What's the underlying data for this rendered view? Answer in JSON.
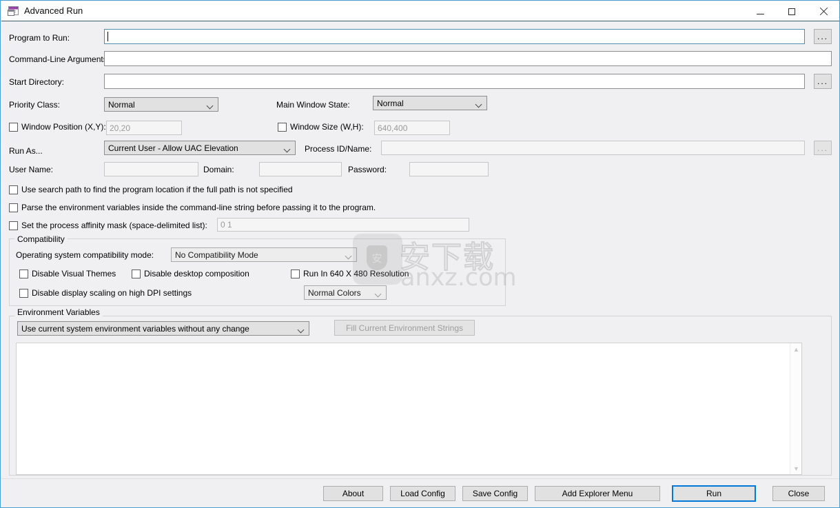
{
  "window": {
    "title": "Advanced Run",
    "icon": "app-window-icon",
    "minimize_label": "Minimize",
    "maximize_label": "Maximize",
    "close_label": "Close",
    "accent_border": "#4a9fd0",
    "client_background": "#f0eff1"
  },
  "fields": {
    "program_to_run": {
      "label": "Program to Run:",
      "value": "",
      "browse_label": "...",
      "focused": true
    },
    "command_line_arguments": {
      "label": "Command-Line Arguments:",
      "value": ""
    },
    "start_directory": {
      "label": "Start Directory:",
      "value": "",
      "browse_label": "..."
    },
    "priority_class": {
      "label": "Priority Class:",
      "value": "Normal"
    },
    "main_window_state": {
      "label": "Main Window State:",
      "value": "Normal"
    },
    "window_position": {
      "label": "Window Position (X,Y):",
      "checked": false,
      "placeholder": "20,20"
    },
    "window_size": {
      "label": "Window Size (W,H):",
      "checked": false,
      "placeholder": "640,400"
    },
    "run_as": {
      "label": "Run As...",
      "value": "Current User - Allow UAC Elevation"
    },
    "process_id_name": {
      "label": "Process ID/Name:",
      "value": "",
      "browse_label": "...",
      "disabled": true
    },
    "user_name": {
      "label": "User Name:",
      "value": "",
      "disabled": true
    },
    "domain": {
      "label": "Domain:",
      "value": "",
      "disabled": true
    },
    "password": {
      "label": "Password:",
      "value": "",
      "disabled": true
    }
  },
  "options": {
    "use_search_path": {
      "label": "Use search path to find the program location if the full path is not specified",
      "checked": false
    },
    "parse_env_vars": {
      "label": "Parse the environment variables inside the command-line string before passing it to the program.",
      "checked": false
    },
    "affinity_mask": {
      "label": "Set the process affinity mask (space-delimited list):",
      "checked": false,
      "placeholder": "0 1"
    }
  },
  "compatibility": {
    "group_title": "Compatibility",
    "os_mode": {
      "label": "Operating system compatibility mode:",
      "value": "No Compatibility Mode"
    },
    "disable_visual_themes": {
      "label": "Disable Visual Themes",
      "checked": false
    },
    "disable_desktop_composition": {
      "label": "Disable desktop composition",
      "checked": false
    },
    "run_640x480": {
      "label": "Run In 640 X 480 Resolution",
      "checked": false
    },
    "disable_dpi_scaling": {
      "label": "Disable display scaling on high DPI settings",
      "checked": false
    },
    "color_mode": {
      "value": "Normal Colors"
    }
  },
  "environment": {
    "group_title": "Environment Variables",
    "mode": {
      "value": "Use current system environment variables without any change"
    },
    "fill_button": {
      "label": "Fill Current Environment Strings",
      "disabled": true
    },
    "list_value": "",
    "scroll_up": "▲",
    "scroll_down": "▼"
  },
  "footer": {
    "about": "About",
    "load_config": "Load Config",
    "save_config": "Save Config",
    "add_explorer_menu": "Add Explorer Menu",
    "run": "Run",
    "close": "Close",
    "default_button_color": "#0078d7"
  },
  "watermark": {
    "cn_text": "安下载",
    "badge_glyph": "安",
    "url": "anxz.com"
  }
}
